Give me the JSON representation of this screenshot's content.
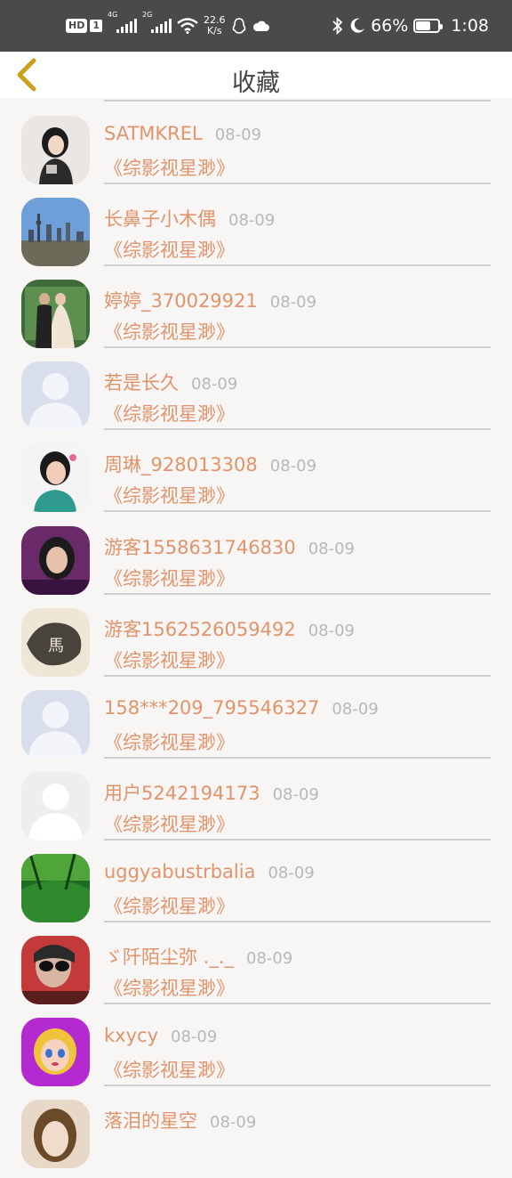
{
  "status_bar": {
    "hd": "HD",
    "sim": "1",
    "net1": "4G",
    "net2": "2G",
    "speed_value": "22.6",
    "speed_unit": "K/s",
    "battery_percent": "66%",
    "battery_level": 0.66,
    "time": "1:08"
  },
  "header": {
    "title": "收藏",
    "back_icon": "chevron-left-icon",
    "back_color": "#c9a11a"
  },
  "colors": {
    "accent": "#e0946a",
    "date": "#b8b8b8",
    "status_bar": "#4a4a4a"
  },
  "items": [
    {
      "name": "SATMKREL",
      "date": "08-09",
      "work": "《综影视星渺》",
      "avatar": "girl-photo"
    },
    {
      "name": "长鼻子小木偶",
      "date": "08-09",
      "work": "《综影视星渺》",
      "avatar": "city-skyline-photo"
    },
    {
      "name": "婷婷_370029921",
      "date": "08-09",
      "work": "《综影视星渺》",
      "avatar": "wedding-photo"
    },
    {
      "name": "若是长久",
      "date": "08-09",
      "work": "《综影视星渺》",
      "avatar": "default-avatar-blue"
    },
    {
      "name": "周琳_928013308",
      "date": "08-09",
      "work": "《综影视星渺》",
      "avatar": "girl-flower-photo"
    },
    {
      "name": "游客1558631746830",
      "date": "08-09",
      "work": "《综影视星渺》",
      "avatar": "woman-selfie-photo"
    },
    {
      "name": "游客1562526059492",
      "date": "08-09",
      "work": "《综影视星渺》",
      "avatar": "ink-horse-painting"
    },
    {
      "name": "158***209_795546327",
      "date": "08-09",
      "work": "《综影视星渺》",
      "avatar": "default-avatar-blue"
    },
    {
      "name": "用户5242194173",
      "date": "08-09",
      "work": "《综影视星渺》",
      "avatar": "default-avatar-gray"
    },
    {
      "name": "uggyabustrbalia",
      "date": "08-09",
      "work": "《综影视星渺》",
      "avatar": "bamboo-forest-photo"
    },
    {
      "name": "ゞ阡陌尘弥 ._._",
      "date": "08-09",
      "work": "《综影视星渺》",
      "avatar": "sunglasses-photo"
    },
    {
      "name": "kxycy",
      "date": "08-09",
      "work": "《综影视星渺》",
      "avatar": "cartoon-doll"
    },
    {
      "name": "落泪的星空",
      "date": "08-09",
      "work": "",
      "avatar": "doll-face"
    }
  ]
}
